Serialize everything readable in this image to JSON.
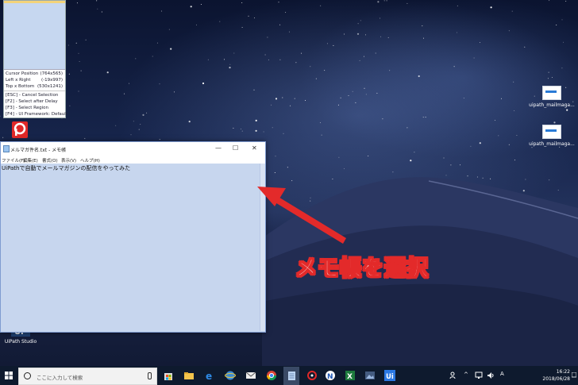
{
  "selector": {
    "rows": [
      {
        "key": "Cursor Position",
        "value": "(764x565)"
      },
      {
        "key": "Left x Right",
        "value": "(-19x997)"
      },
      {
        "key": "Top x Bottom",
        "value": "(530x1241)"
      }
    ],
    "shortcuts": [
      "[ESC] - Cancel Selection",
      "[F2]   - Select after Delay",
      "[F3]   - Select Region",
      "[F4]   - UI Framework: Default"
    ]
  },
  "desktop_icons": {
    "mail1": "uipath_mailmaga...",
    "mail2": "uipath_mailmaga...",
    "studio": "UiPath Studio"
  },
  "notepad": {
    "title": "メルマガ件名.txt - メモ帳",
    "menu": [
      "ファイル(F)",
      "編集(E)",
      "書式(O)",
      "表示(V)",
      "ヘルプ(H)"
    ],
    "content": "UiPathで自動でメールマガジンの配信をやってみた"
  },
  "annotation": {
    "callout": "メモ帳を選択",
    "color": "#e32a2a"
  },
  "taskbar": {
    "search_placeholder": "ここに入力して検索",
    "time": "16:22",
    "date": "2018/06/28",
    "pinned": [
      "store-icon",
      "explorer-icon",
      "edge-icon",
      "internet-icon",
      "mail-icon",
      "chrome-icon",
      "notepad-icon",
      "record-icon",
      "excel-icon",
      "photos-icon",
      "uipath-icon"
    ]
  }
}
